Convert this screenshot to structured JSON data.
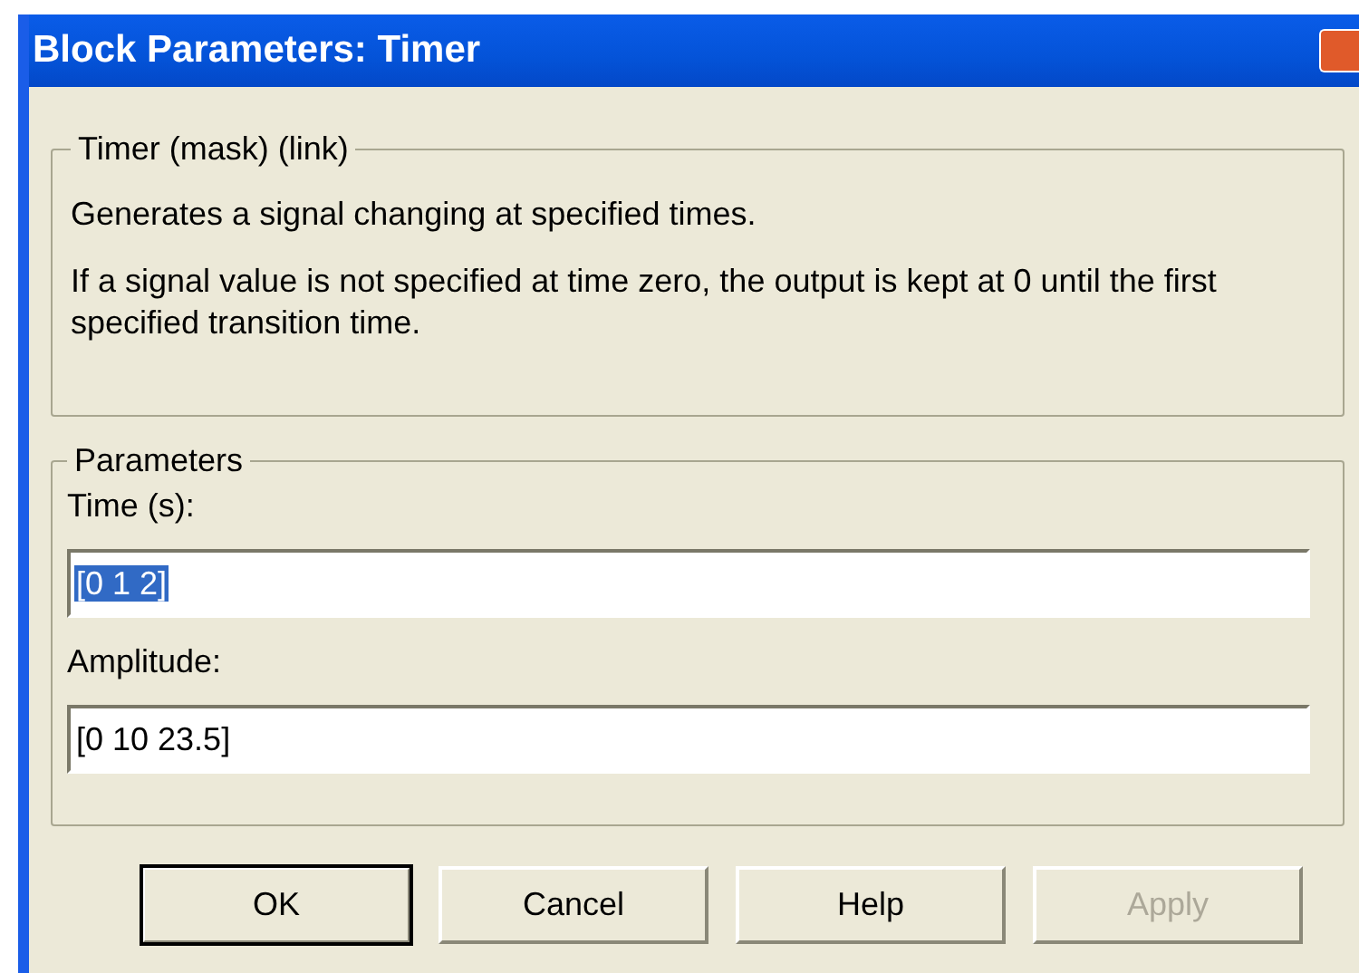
{
  "window": {
    "title": "Block Parameters: Timer"
  },
  "description": {
    "title": "Timer (mask) (link)",
    "paragraphs": [
      "Generates a signal changing at specified times.",
      "If a signal value is not specified at time zero, the output is kept at 0 until the first specified transition time."
    ]
  },
  "parameters": {
    "title": "Parameters",
    "fields": [
      {
        "label": "Time (s):",
        "value": "[0 1 2]",
        "selected": true
      },
      {
        "label": "Amplitude:",
        "value": "[0 10 23.5]",
        "selected": false
      }
    ]
  },
  "buttons": [
    {
      "label": "OK",
      "default": true,
      "disabled": false
    },
    {
      "label": "Cancel",
      "default": false,
      "disabled": false
    },
    {
      "label": "Help",
      "default": false,
      "disabled": false
    },
    {
      "label": "Apply",
      "default": false,
      "disabled": true
    }
  ]
}
